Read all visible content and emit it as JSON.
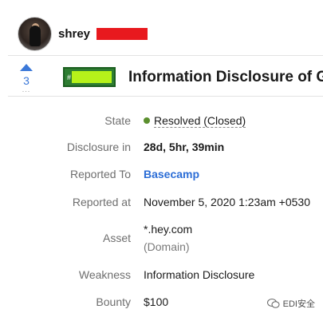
{
  "user": {
    "name": "shrey"
  },
  "vote": {
    "count": "3",
    "dots": "..."
  },
  "report": {
    "badge_prefix": "#",
    "title": "Information Disclosure of G"
  },
  "details": {
    "state_label": "State",
    "state_value": "Resolved (Closed)",
    "disclosure_label": "Disclosure in",
    "disclosure_value": "28d, 5hr, 39min",
    "reported_to_label": "Reported To",
    "reported_to_value": "Basecamp",
    "reported_at_label": "Reported at",
    "reported_at_value": "November 5, 2020 1:23am +0530",
    "asset_label": "Asset",
    "asset_value": "*.hey.com",
    "asset_type": "(Domain)",
    "weakness_label": "Weakness",
    "weakness_value": "Information Disclosure",
    "bounty_label": "Bounty",
    "bounty_value": "$100"
  },
  "watermark": {
    "text": "EDI安全"
  },
  "colors": {
    "redaction_red": "#e8191e",
    "redaction_green": "#b6f21a",
    "badge_green": "#2e7d32",
    "link_blue": "#2b6dd6",
    "status_green": "#5b8f2e"
  }
}
